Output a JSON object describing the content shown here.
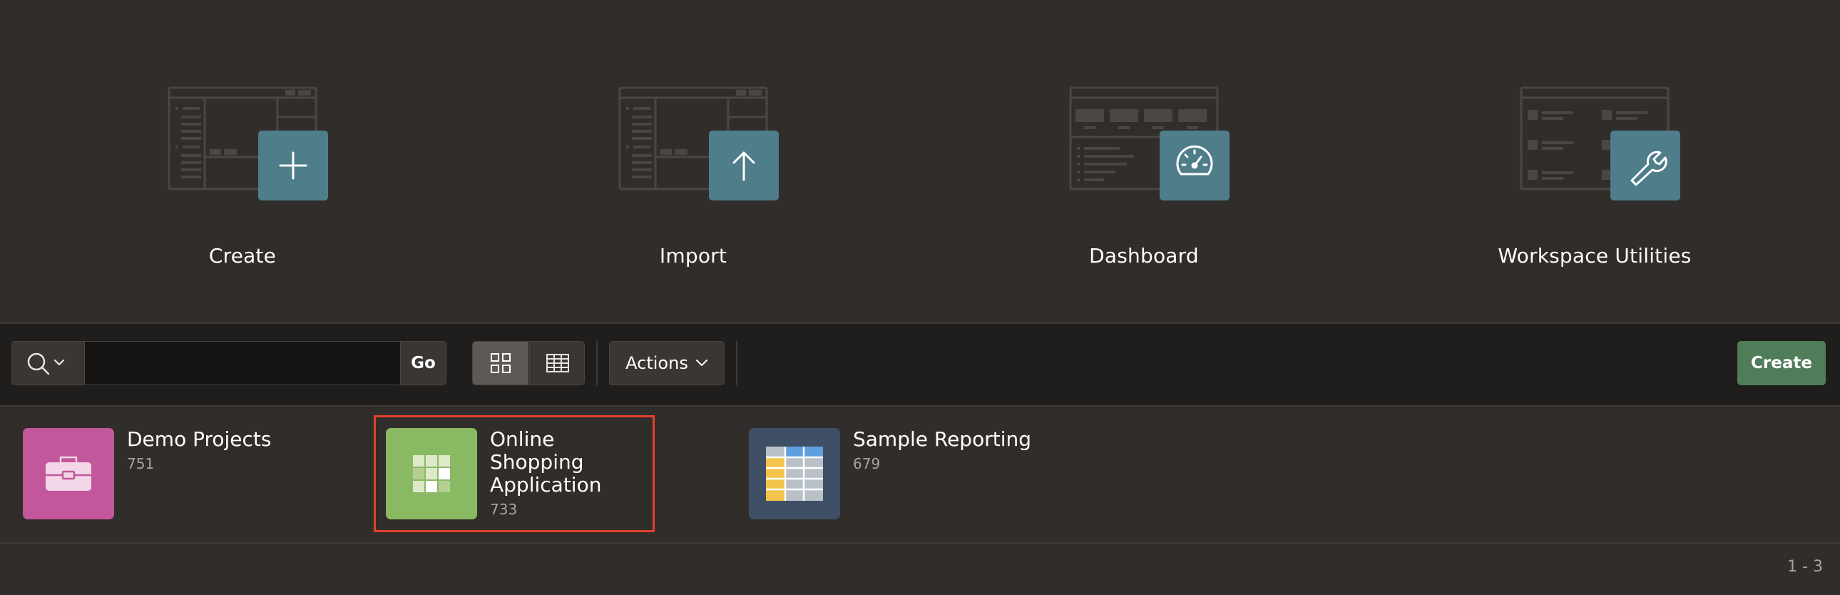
{
  "hero_tiles": [
    {
      "label": "Create",
      "badge_icon": "plus-icon"
    },
    {
      "label": "Import",
      "badge_icon": "arrow-up-icon"
    },
    {
      "label": "Dashboard",
      "badge_icon": "speedometer-icon"
    },
    {
      "label": "Workspace Utilities",
      "badge_icon": "wrench-icon"
    }
  ],
  "toolbar": {
    "search_value": "",
    "go_label": "Go",
    "actions_label": "Actions",
    "create_label": "Create"
  },
  "apps": [
    {
      "name": "Demo Projects",
      "id": "751",
      "color": "#c3579b",
      "icon": "toolbox-icon"
    },
    {
      "name": "Online Shopping Application",
      "id": "733",
      "color": "#8ab964",
      "icon": "grid-icon"
    },
    {
      "name": "Sample Reporting",
      "id": "679",
      "color": "#3f5066",
      "icon": "table-icon"
    }
  ],
  "pagination": "1 - 3",
  "colors": {
    "background": "#312d2a",
    "toolbar_background": "#201e1c",
    "badge": "#4f7d8a",
    "create_button": "#4f7d5a",
    "selection_border": "#e2402e"
  }
}
